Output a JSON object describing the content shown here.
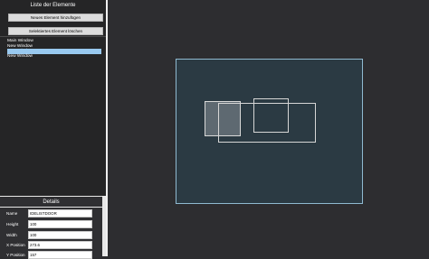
{
  "sidebar": {
    "title": "Liste der Elemente",
    "add_button": "Neues Element hinzufügen",
    "delete_button": "Selektiertes Element löschen",
    "items": [
      {
        "label": "Main Window"
      },
      {
        "label": "New Window"
      },
      {
        "label": "New Window"
      },
      {
        "label": "New Window"
      }
    ]
  },
  "details": {
    "title": "Details",
    "fields": [
      {
        "label": "Name",
        "value": "IDELISTDOOR"
      },
      {
        "label": "Height",
        "value": "100"
      },
      {
        "label": "Width",
        "value": "100"
      },
      {
        "label": "X Position",
        "value": "273.6"
      },
      {
        "label": "Y Position",
        "value": "157"
      }
    ]
  },
  "colors": {
    "canvas_bg": "#2b3a43",
    "canvas_border": "#8fb9d0",
    "selection": "#99c9ef"
  }
}
